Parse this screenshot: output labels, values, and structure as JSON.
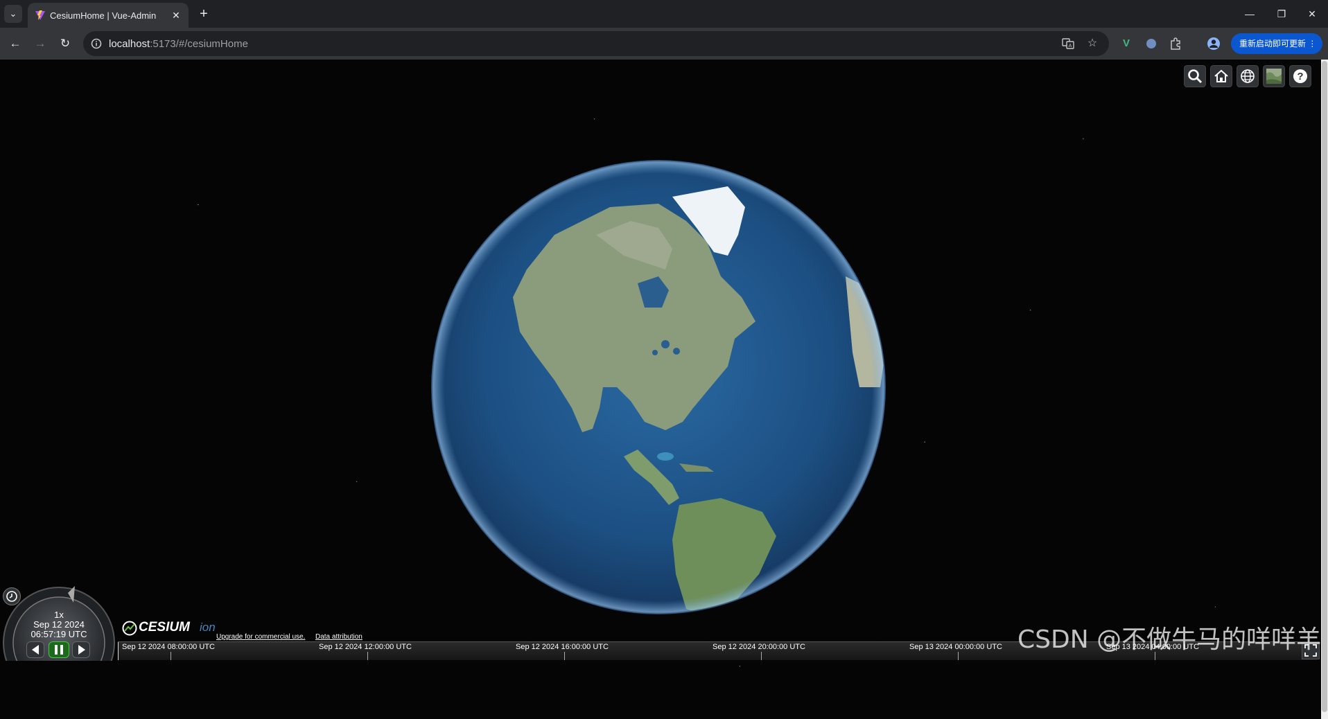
{
  "browser": {
    "tab": {
      "title": "CesiumHome | Vue-Admin",
      "close": "✕"
    },
    "new_tab": "+",
    "tab_list": "⌄",
    "window": {
      "minimize": "—",
      "restore": "❐",
      "close": "✕"
    },
    "nav": {
      "back": "←",
      "forward": "→",
      "reload": "↻"
    },
    "address": {
      "host": "localhost",
      "path": ":5173/#/cesiumHome"
    },
    "update_button": "重新启动即可更新 ⋮",
    "icons": [
      "translate-icon",
      "bookmark-star-icon",
      "vue-devtools-icon",
      "extension-circle-icon",
      "extensions-puzzle-icon",
      "profile-icon"
    ]
  },
  "cesium": {
    "toolbar": [
      "geocoder-search-icon",
      "home-icon",
      "scene-mode-globe-icon",
      "base-layer-picker-icon",
      "help-icon"
    ],
    "animation": {
      "speed": "1x",
      "date": "Sep 12 2024",
      "time": "06:57:19 UTC"
    },
    "credits": {
      "logo": "CESIUM",
      "logo_suffix": "ion",
      "upgrade": "Upgrade for commercial use.",
      "attribution": "Data attribution"
    },
    "timeline": {
      "labels": [
        "Sep 12 2024 08:00:00 UTC",
        "Sep 12 2024 12:00:00 UTC",
        "Sep 12 2024 16:00:00 UTC",
        "Sep 12 2024 20:00:00 UTC",
        "Sep 13 2024 00:00:00 UTC",
        "Sep 13 2024 04:00:00 UTC"
      ]
    }
  },
  "watermark": "CSDN @不做牛马的咩咩羊",
  "colors": {
    "chrome_dark": "#202124",
    "chrome_toolbar": "#35363a",
    "update_blue": "#0b57d0",
    "ocean": "#1f5a8e",
    "pause_green": "#4ec34e"
  }
}
